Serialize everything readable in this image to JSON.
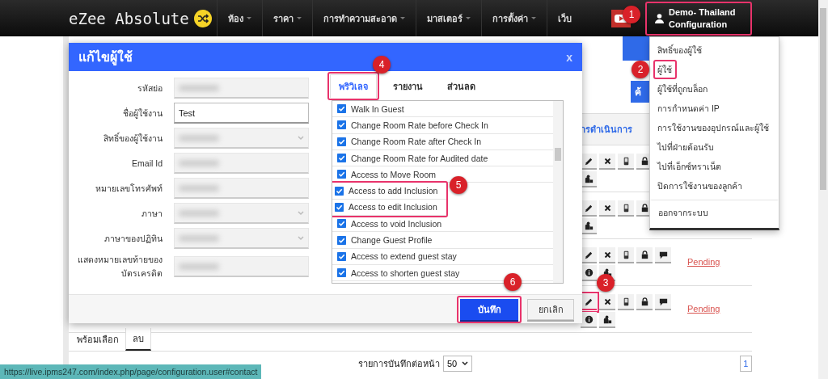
{
  "navbar": {
    "brand": "eZee Absolute",
    "menu": [
      {
        "label": "ห้อง",
        "dropdown": true
      },
      {
        "label": "ราคา",
        "dropdown": true
      },
      {
        "label": "การทำความสะอาด",
        "dropdown": true
      },
      {
        "label": "มาสเตอร์",
        "dropdown": true
      },
      {
        "label": "การตั้งค่า",
        "dropdown": true
      },
      {
        "label": "เว็บ",
        "dropdown": false
      }
    ],
    "user": {
      "line1": "Demo- Thailand",
      "line2": "Configuration",
      "highlighted": true,
      "callout": "1"
    }
  },
  "user_menu": [
    {
      "label": "สิทธิ์ของผู้ใช้",
      "highlighted": false,
      "separated": false
    },
    {
      "label": "ผู้ใช้",
      "highlighted": true,
      "callout": "2",
      "separated": false
    },
    {
      "label": "ผู้ใช้ที่ถูกบล็อก",
      "highlighted": false,
      "separated": false
    },
    {
      "label": "การกำหนดค่า IP",
      "highlighted": false,
      "separated": false
    },
    {
      "label": "การใช้งานของอุปกรณ์และผู้ใช้",
      "highlighted": false,
      "separated": false
    },
    {
      "label": "ไปที่ฝ่ายต้อนรับ",
      "highlighted": false,
      "separated": false
    },
    {
      "label": "ไปที่เอ็กซ์ทราเน็ต",
      "highlighted": false,
      "separated": false
    },
    {
      "label": "ปิดการใช้งานของลูกค้า",
      "highlighted": false,
      "separated": false
    },
    {
      "label": "ออกจากระบบ",
      "highlighted": false,
      "separated": true
    }
  ],
  "page": {
    "search_button": "ค้",
    "table": {
      "header_link": "ารดำเนินการ",
      "rows": [
        {
          "kind": "covered"
        },
        {
          "kind": "covered"
        },
        {
          "kind": "full",
          "status": "Pending",
          "edit_highlighted": false
        },
        {
          "kind": "full",
          "status": "Pending",
          "edit_highlighted": true,
          "callout": "3"
        }
      ]
    },
    "bulk_tabs": [
      {
        "label": "พร้อมเลือก",
        "selected": false
      },
      {
        "label": "ลบ",
        "selected": true
      }
    ],
    "per_page_label": "รายการบันทึกต่อหน้า",
    "per_page": "50",
    "current_page": "1"
  },
  "dialog": {
    "title": "แก้ไขผู้ใช้",
    "close": "x",
    "fields": [
      {
        "label": "รหัสย่อ",
        "kind": "text",
        "blurred": true
      },
      {
        "label": "ชื่อผู้ใช้งาน",
        "kind": "text",
        "value": "Test",
        "blurred": false
      },
      {
        "label": "สิทธิ์ของผู้ใช้งาน",
        "kind": "select",
        "blurred": true
      },
      {
        "label": "Email Id",
        "kind": "text",
        "blurred": true
      },
      {
        "label": "หมายเลขโทรศัพท์",
        "kind": "text",
        "blurred": true
      },
      {
        "label": "ภาษา",
        "kind": "select",
        "blurred": true
      },
      {
        "label": "ภาษาของปฏิทิน",
        "kind": "select",
        "blurred": true
      },
      {
        "label": "แสดงหมายเลขท้ายของบัตรเครดิต",
        "kind": "text",
        "blurred": true
      }
    ],
    "tabs": [
      {
        "label": "พริวิเลจ",
        "selected": true,
        "highlighted": true,
        "callout": "4"
      },
      {
        "label": "รายงาน",
        "selected": false,
        "highlighted": false
      },
      {
        "label": "ส่วนลด",
        "selected": false,
        "highlighted": false
      }
    ],
    "privileges": [
      {
        "label": "Walk In Guest",
        "checked": true,
        "highlighted": false
      },
      {
        "label": "Change Room Rate before Check In",
        "checked": true,
        "highlighted": false
      },
      {
        "label": "Change Room Rate after Check In",
        "checked": true,
        "highlighted": false
      },
      {
        "label": "Change Room Rate for Audited date",
        "checked": true,
        "highlighted": false
      },
      {
        "label": "Access to Move Room",
        "checked": true,
        "highlighted": false
      },
      {
        "label": "Access to add Inclusion",
        "checked": true,
        "highlighted": true,
        "callout": "5"
      },
      {
        "label": "Access to edit Inclusion",
        "checked": true,
        "highlighted": true
      },
      {
        "label": "Access to void Inclusion",
        "checked": true,
        "highlighted": false
      },
      {
        "label": "Change Guest Profile",
        "checked": true,
        "highlighted": false
      },
      {
        "label": "Access to extend guest stay",
        "checked": true,
        "highlighted": false
      },
      {
        "label": "Access to shorten guest stay",
        "checked": true,
        "highlighted": false
      }
    ],
    "save": {
      "label": "บันทึก",
      "highlighted": true,
      "callout": "6"
    },
    "cancel": {
      "label": "ยกเลิก"
    }
  },
  "status_url": "https://live.ipms247.com/index.php/page/configuration.user#contact"
}
